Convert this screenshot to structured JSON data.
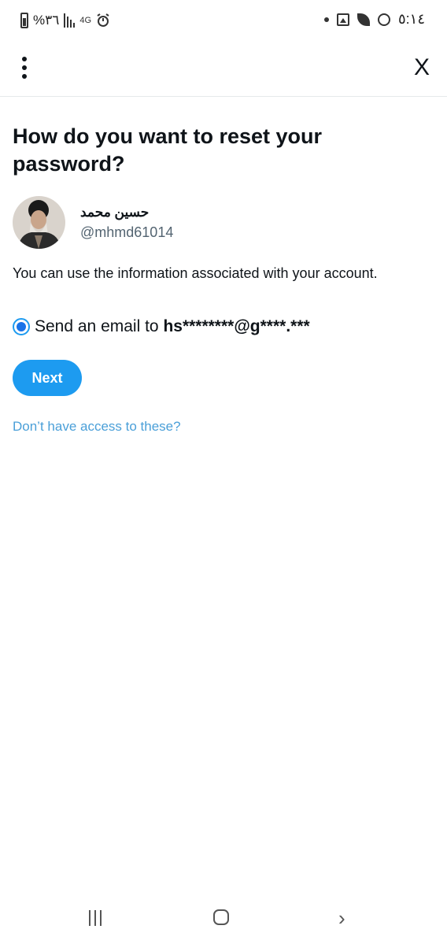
{
  "status_bar": {
    "battery_text": "%٣٦",
    "network_small": "4G",
    "time": "٥:١٤"
  },
  "header": {
    "close_label": "X"
  },
  "page": {
    "title": "How do you want to reset your password?",
    "account": {
      "display_name": "حسين محمد",
      "handle": "@mhmd61014"
    },
    "info_text": "You can use the information associated with your account.",
    "option": {
      "prefix": "Send an email to ",
      "masked_email": "hs********@g****.***",
      "selected": true
    },
    "next_label": "Next",
    "access_link": "Don’t have access to these?"
  },
  "colors": {
    "accent": "#1d9bf0",
    "radio_fill": "#1a73e8",
    "link": "#4a9fd8",
    "secondary_text": "#536471"
  }
}
